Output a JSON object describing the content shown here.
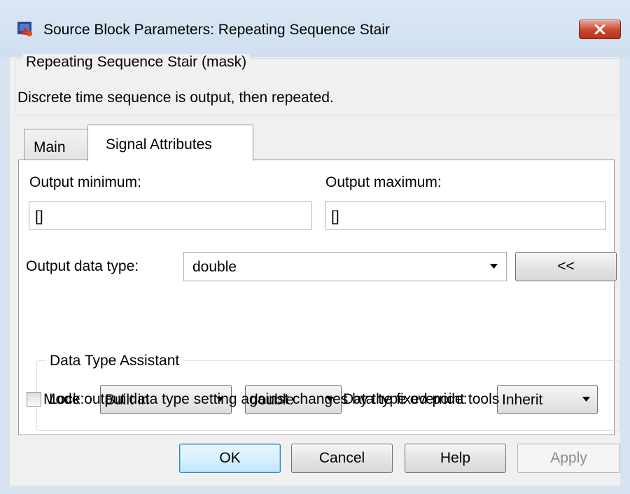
{
  "window": {
    "title": "Source Block Parameters: Repeating Sequence Stair",
    "icon": "simulink-block-icon",
    "close_icon": "close-icon"
  },
  "description": {
    "legend": "Repeating Sequence Stair (mask)",
    "text": "Discrete time sequence is output, then repeated."
  },
  "tabs": [
    {
      "label": "Main",
      "selected": false
    },
    {
      "label": "Signal Attributes",
      "selected": true
    }
  ],
  "signal_attributes": {
    "output_minimum": {
      "label": "Output minimum:",
      "value": "[]"
    },
    "output_maximum": {
      "label": "Output maximum:",
      "value": "[]"
    },
    "output_data_type": {
      "label": "Output data type:",
      "value": "double"
    },
    "assistant_toggle_label": "<<",
    "data_type_assistant": {
      "legend": "Data Type Assistant",
      "mode_label": "Mode:",
      "mode_value": "Built in",
      "builtin_value": "double",
      "override_label": "Data type override:",
      "override_value": "Inherit"
    },
    "lock_checkbox": {
      "label": "Lock output data type setting against changes by the fixed-point tools",
      "checked": false
    }
  },
  "buttons": {
    "ok": "OK",
    "cancel": "Cancel",
    "help": "Help",
    "apply": "Apply"
  },
  "colors": {
    "title_bar": "#d6e4f2",
    "close_button": "#c9452e",
    "panel": "#ffffff",
    "dialog_bg": "#f0f0f0"
  }
}
